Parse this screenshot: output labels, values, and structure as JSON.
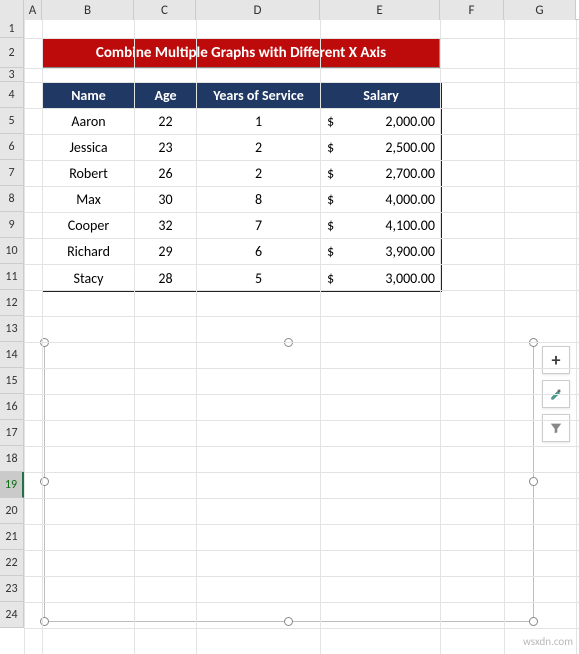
{
  "columns": [
    {
      "label": "A",
      "w": 18
    },
    {
      "label": "B",
      "w": 92
    },
    {
      "label": "C",
      "w": 62
    },
    {
      "label": "D",
      "w": 124
    },
    {
      "label": "E",
      "w": 120
    },
    {
      "label": "F",
      "w": 64
    },
    {
      "label": "G",
      "w": 72
    }
  ],
  "rows": [
    {
      "n": "1",
      "h": 18
    },
    {
      "n": "2",
      "h": 30
    },
    {
      "n": "3",
      "h": 14
    },
    {
      "n": "4",
      "h": 26
    },
    {
      "n": "5",
      "h": 26
    },
    {
      "n": "6",
      "h": 26
    },
    {
      "n": "7",
      "h": 26
    },
    {
      "n": "8",
      "h": 26
    },
    {
      "n": "9",
      "h": 26
    },
    {
      "n": "10",
      "h": 26
    },
    {
      "n": "11",
      "h": 26
    },
    {
      "n": "12",
      "h": 26
    },
    {
      "n": "13",
      "h": 26
    },
    {
      "n": "14",
      "h": 26
    },
    {
      "n": "15",
      "h": 26
    },
    {
      "n": "16",
      "h": 26
    },
    {
      "n": "17",
      "h": 26
    },
    {
      "n": "18",
      "h": 26
    },
    {
      "n": "19",
      "h": 26
    },
    {
      "n": "20",
      "h": 26
    },
    {
      "n": "21",
      "h": 26
    },
    {
      "n": "22",
      "h": 26
    },
    {
      "n": "23",
      "h": 26
    },
    {
      "n": "24",
      "h": 26
    }
  ],
  "selected_row": "19",
  "banner": {
    "text": "Combine Multiple Graphs with Different X Axis"
  },
  "table": {
    "headers": {
      "name": "Name",
      "age": "Age",
      "yos": "Years of Service",
      "salary": "Salary"
    },
    "currency": "$",
    "data": [
      {
        "name": "Aaron",
        "age": "22",
        "yos": "1",
        "salary": "2,000.00"
      },
      {
        "name": "Jessica",
        "age": "23",
        "yos": "2",
        "salary": "2,500.00"
      },
      {
        "name": "Robert",
        "age": "26",
        "yos": "2",
        "salary": "2,700.00"
      },
      {
        "name": "Max",
        "age": "30",
        "yos": "8",
        "salary": "4,000.00"
      },
      {
        "name": "Cooper",
        "age": "32",
        "yos": "7",
        "salary": "4,100.00"
      },
      {
        "name": "Richard",
        "age": "29",
        "yos": "6",
        "salary": "3,900.00"
      },
      {
        "name": "Stacy",
        "age": "28",
        "yos": "5",
        "salary": "3,000.00"
      }
    ]
  },
  "watermark": "wsxdn.com"
}
